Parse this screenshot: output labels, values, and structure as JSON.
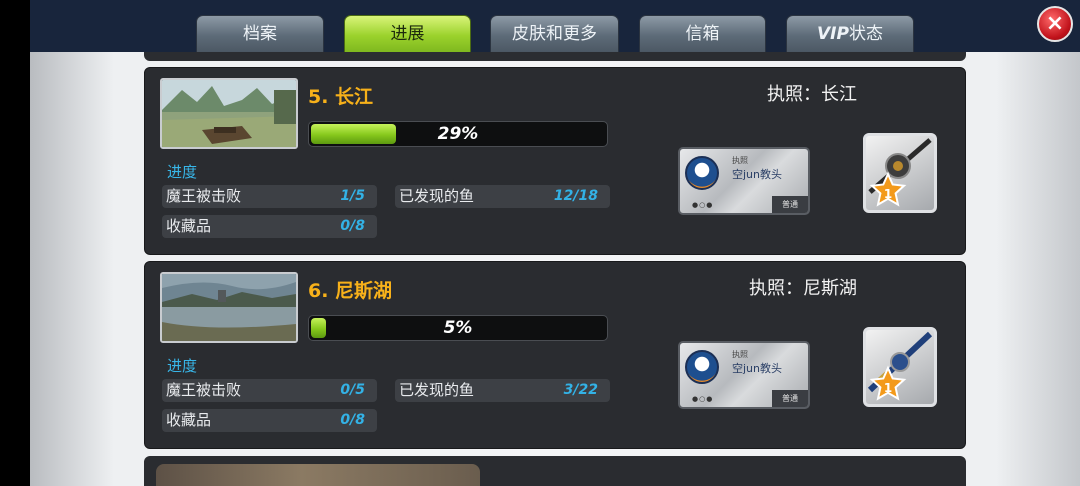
{
  "tabs": [
    {
      "label": "档案",
      "active": false
    },
    {
      "label": "进展",
      "active": true
    },
    {
      "label": "皮肤和更多",
      "active": false
    },
    {
      "label": "信箱",
      "active": false
    },
    {
      "label_vip": "VIP",
      "label": "状态",
      "active": false
    }
  ],
  "close_icon": "×",
  "lakes": [
    {
      "title": "5. 长江",
      "progress": 29,
      "progress_label": "29%",
      "section_label": "进度",
      "boss_label": "魔王被击败",
      "boss_value": "1/5",
      "fish_label": "已发现的鱼",
      "fish_value": "12/18",
      "collect_label": "收藏品",
      "collect_value": "0/8",
      "license_title": "执照：长江",
      "license_card": {
        "tag": "执照",
        "name": "空jun教头",
        "grade": "普通",
        "dots": "●○●"
      },
      "rod_level": "1"
    },
    {
      "title": "6. 尼斯湖",
      "progress": 5,
      "progress_label": "5%",
      "section_label": "进度",
      "boss_label": "魔王被击败",
      "boss_value": "0/5",
      "fish_label": "已发现的鱼",
      "fish_value": "3/22",
      "collect_label": "收藏品",
      "collect_value": "0/8",
      "license_title": "执照：尼斯湖",
      "license_card": {
        "tag": "执照",
        "name": "空jun教头",
        "grade": "普通",
        "dots": "●○●"
      },
      "rod_level": "1"
    }
  ],
  "colors": {
    "accent_green": "#9bd22c",
    "title_orange": "#f7b11a",
    "value_blue": "#33b2e6",
    "panel": "#2a2c30",
    "close_red": "#c1121b"
  }
}
